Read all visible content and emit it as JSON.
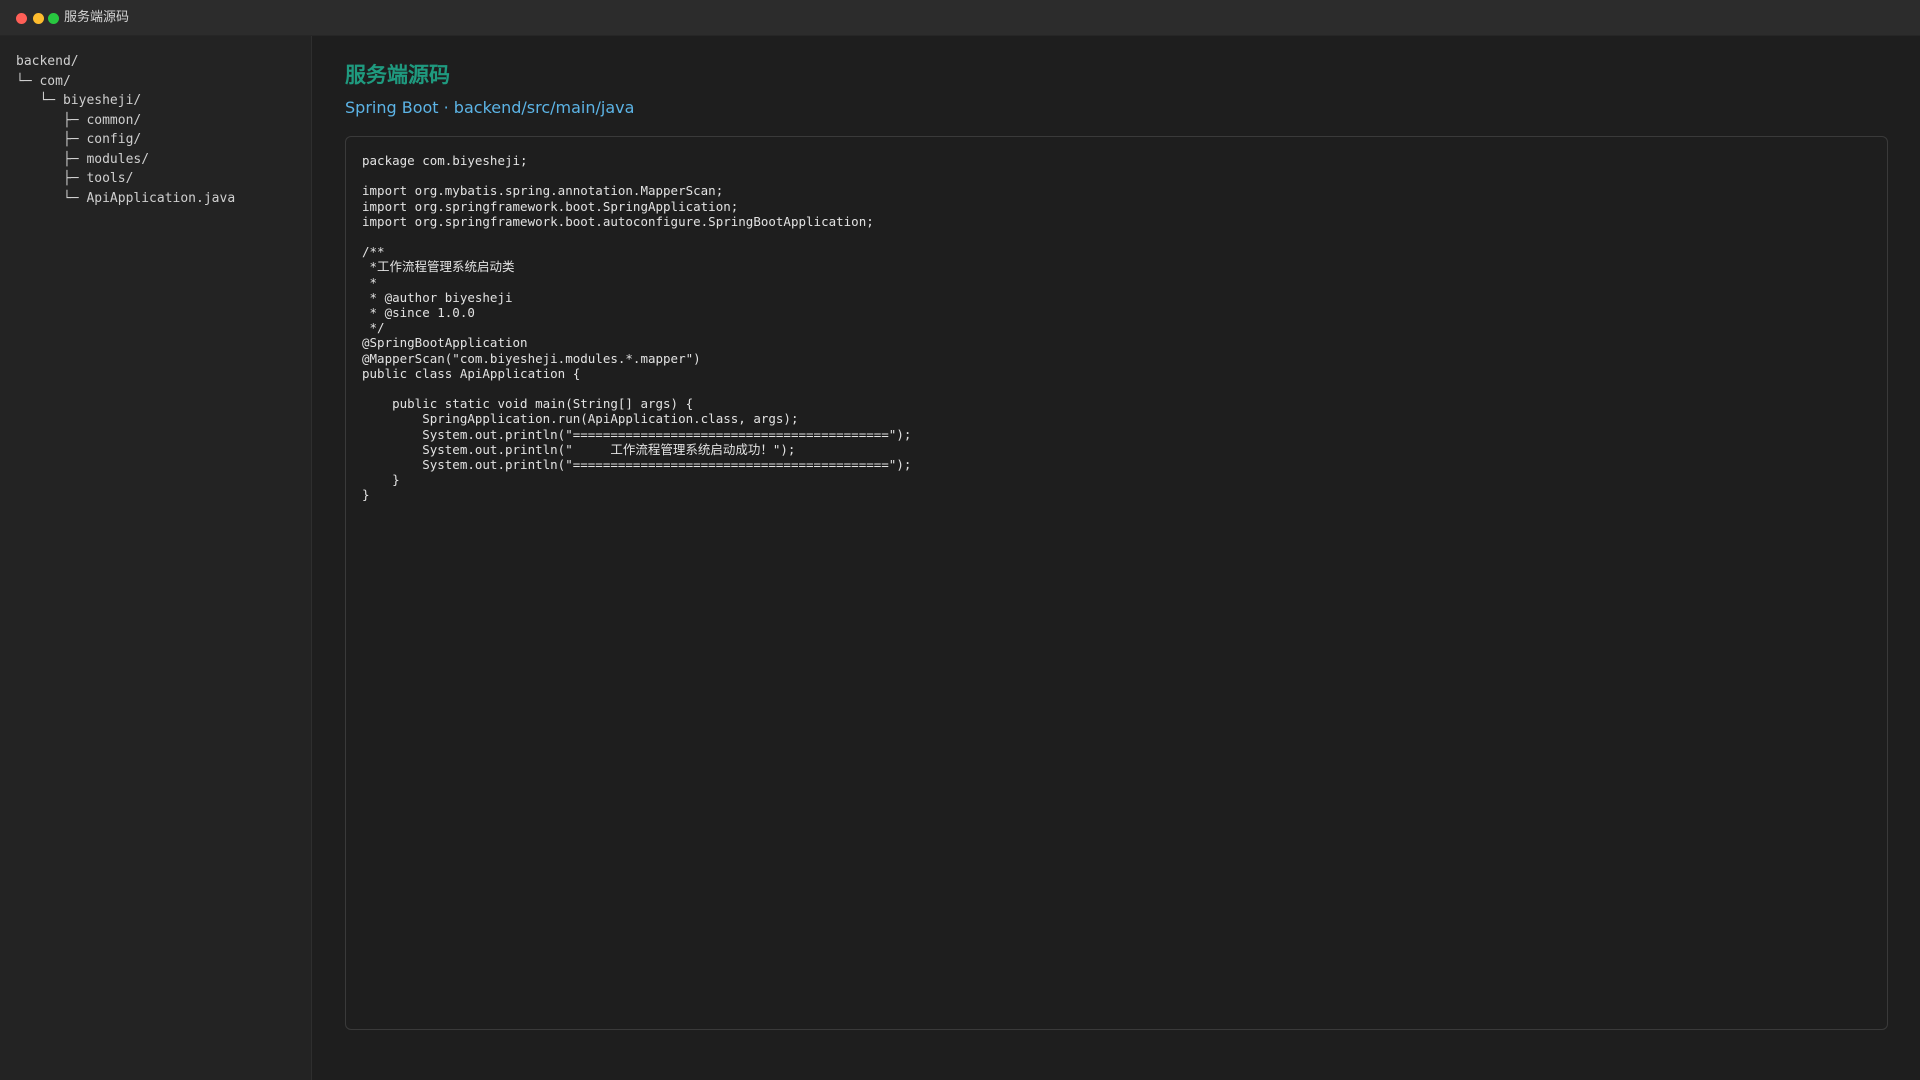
{
  "window": {
    "title": "服务端源码"
  },
  "sidebar": {
    "tree": [
      "backend/",
      "└─ com/",
      "   └─ biyesheji/",
      "      ├─ common/",
      "      ├─ config/",
      "      ├─ modules/",
      "      ├─ tools/",
      "      └─ ApiApplication.java"
    ]
  },
  "main": {
    "title": "服务端源码",
    "subtitle": "Spring Boot · backend/src/main/java",
    "code_lines": [
      "package com.biyesheji;",
      "",
      "import org.mybatis.spring.annotation.MapperScan;",
      "import org.springframework.boot.SpringApplication;",
      "import org.springframework.boot.autoconfigure.SpringBootApplication;",
      "",
      "/**",
      " *工作流程管理系统启动类",
      " *",
      " * @author biyesheji",
      " * @since 1.0.0",
      " */",
      "@SpringBootApplication",
      "@MapperScan(\"com.biyesheji.modules.*.mapper\")",
      "public class ApiApplication {",
      "",
      "    public static void main(String[] args) {",
      "        SpringApplication.run(ApiApplication.class, args);",
      "        System.out.println(\"==========================================\");",
      "        System.out.println(\"     工作流程管理系统启动成功！\");",
      "        System.out.println(\"==========================================\");",
      "    }",
      "}"
    ]
  },
  "colors": {
    "accent_title": "#1f9a7f",
    "accent_subtitle": "#5cb4e6",
    "traffic_close": "#ff5f57",
    "traffic_minimize": "#febc2e",
    "traffic_maximize": "#28c840"
  }
}
